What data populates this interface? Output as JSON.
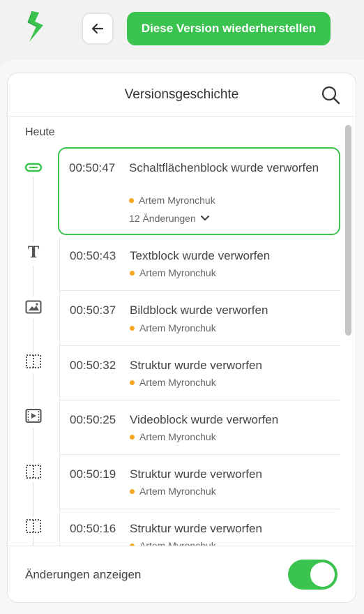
{
  "toolbar": {
    "restore_label": "Diese Version wiederherstellen",
    "back_icon": "arrow-left-icon",
    "logo_icon": "bolt-logo-icon",
    "accent": "#3ac34f"
  },
  "panel": {
    "title": "Versionsgeschichte",
    "search_icon": "search-icon",
    "day_label": "Heute",
    "entries": [
      {
        "time": "00:50:47",
        "title": "Schaltflächenblock wurde verworfen",
        "author": "Artem Myronchuk",
        "changes": "12 Änderungen",
        "icon": "button-block-icon",
        "active": true
      },
      {
        "time": "00:50:43",
        "title": "Textblock wurde verworfen",
        "author": "Artem Myronchuk",
        "icon": "text-block-icon"
      },
      {
        "time": "00:50:37",
        "title": "Bildblock wurde verworfen",
        "author": "Artem Myronchuk",
        "icon": "image-block-icon"
      },
      {
        "time": "00:50:32",
        "title": "Struktur wurde verworfen",
        "author": "Artem Myronchuk",
        "icon": "structure-icon"
      },
      {
        "time": "00:50:25",
        "title": "Videoblock wurde verworfen",
        "author": "Artem Myronchuk",
        "icon": "video-block-icon"
      },
      {
        "time": "00:50:19",
        "title": "Struktur wurde verworfen",
        "author": "Artem Myronchuk",
        "icon": "structure-icon"
      },
      {
        "time": "00:50:16",
        "title": "Struktur wurde verworfen",
        "author": "Artem Myronchuk",
        "icon": "structure-icon"
      }
    ]
  },
  "footer": {
    "label": "Änderungen anzeigen",
    "toggle_on": true
  }
}
